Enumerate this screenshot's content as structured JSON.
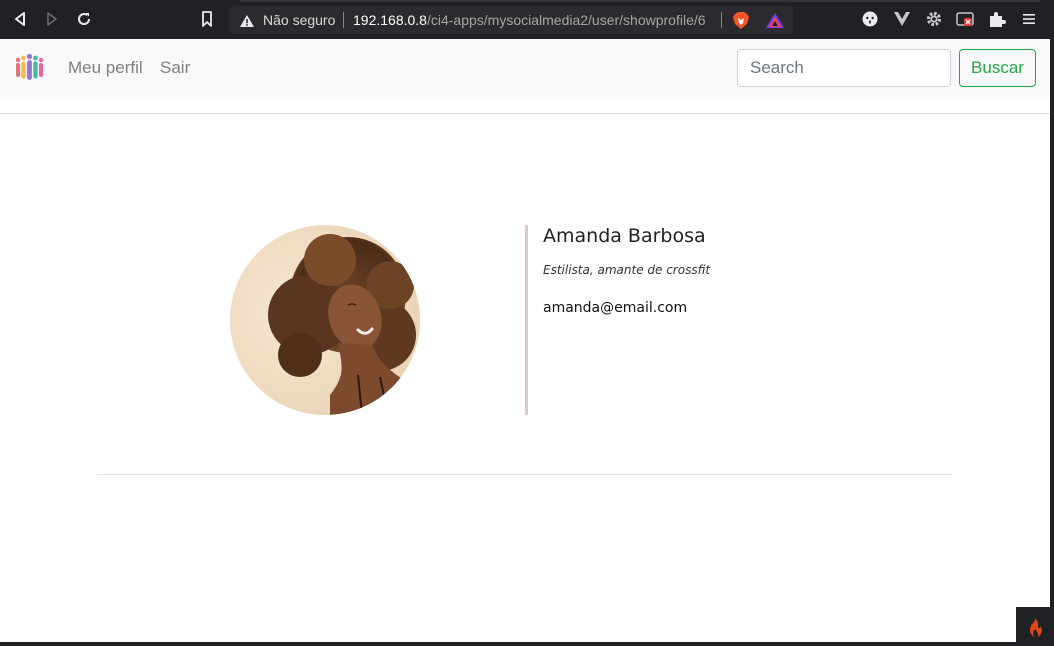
{
  "browser": {
    "not_secure_label": "Não seguro",
    "url_host": "192.168.0.8",
    "url_path": "/ci4-apps/mysocialmedia2/user/showprofile/6"
  },
  "navbar": {
    "links": [
      {
        "label": "Meu perfil"
      },
      {
        "label": "Sair"
      }
    ],
    "search": {
      "placeholder": "Search"
    },
    "search_button_label": "Buscar"
  },
  "profile": {
    "name": "Amanda Barbosa",
    "bio": "Estilista, amante de crossfit",
    "email": "amanda@email.com"
  },
  "colors": {
    "accent_success": "#28a745",
    "navbar_bg": "#f8f9fa",
    "divider_accent": "#e0c9cd",
    "chrome_bg": "#202124"
  },
  "icons": {
    "back": "back-icon",
    "forward": "forward-icon",
    "reload": "reload-icon",
    "bookmark": "bookmark-icon",
    "warning": "warning-icon",
    "brave": "brave-shield-icon",
    "rewards": "brave-rewards-icon",
    "extensions": "puzzle-icon",
    "menu": "menu-icon",
    "codeigniter": "codeigniter-flame-icon"
  }
}
